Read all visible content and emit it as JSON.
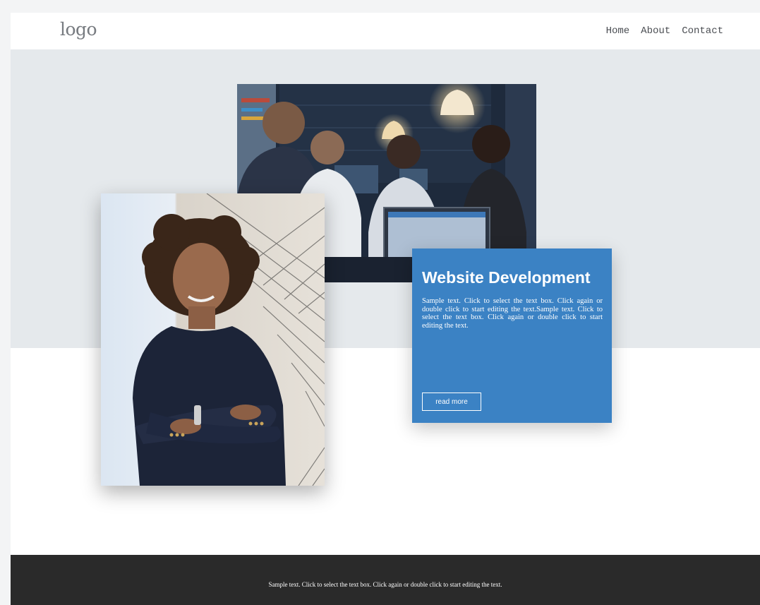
{
  "header": {
    "logo": "logo",
    "nav": [
      {
        "label": "Home"
      },
      {
        "label": "About"
      },
      {
        "label": "Contact"
      }
    ]
  },
  "card": {
    "title": "Website Development",
    "body": "Sample text. Click to select the text box. Click again or double click to start editing the text.Sample text. Click to select the text box. Click again or double click to start editing the text.",
    "button_label": "read more"
  },
  "footer": {
    "text": "Sample text. Click to select the text box. Click again or double click to start editing the text."
  },
  "colors": {
    "band": "#e5e9ec",
    "card": "#3b82c4",
    "footer": "#2a2a2a"
  }
}
